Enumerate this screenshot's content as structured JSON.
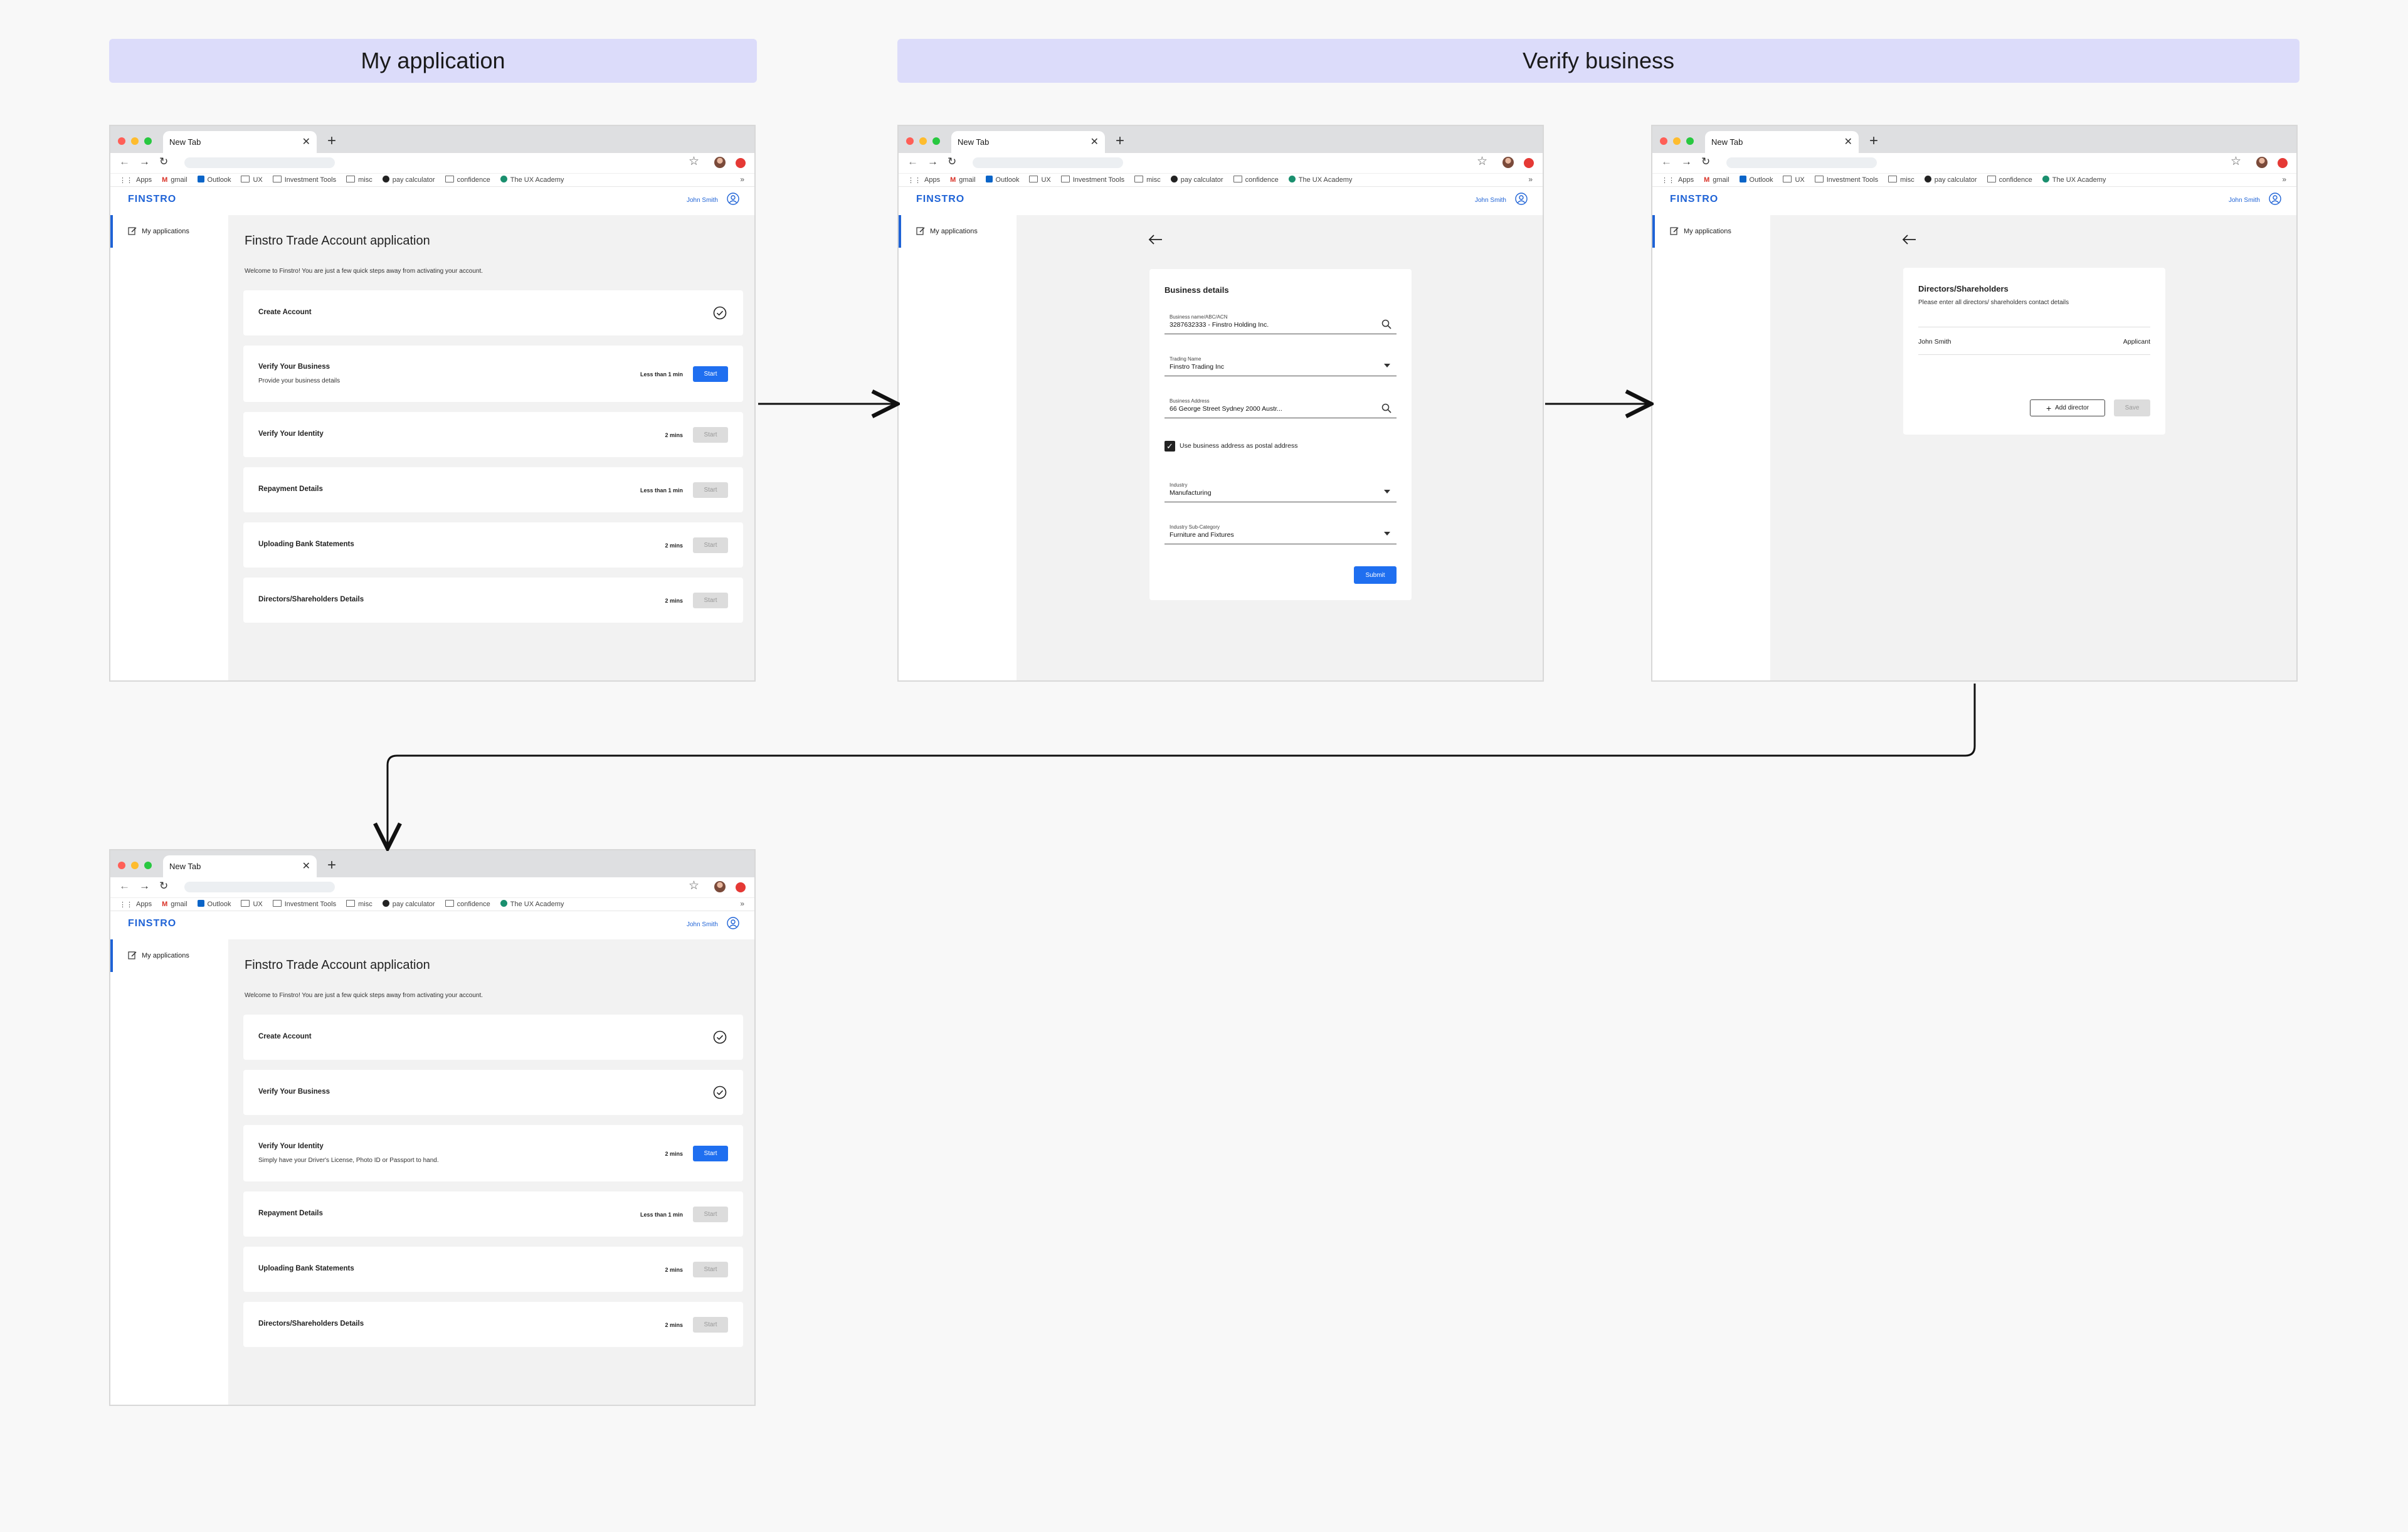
{
  "headers": {
    "my_application": "My application",
    "verify_business": "Verify business"
  },
  "colors": {
    "accent": "#1f63d6",
    "header_bg": "#dcdcfa",
    "primary_button": "#1f6ff0",
    "traffic_red": "#ff5f57",
    "traffic_yellow": "#febc2e",
    "traffic_green": "#28c840"
  },
  "browser": {
    "tab_title": "New Tab",
    "bookmarks": [
      {
        "label": "Apps",
        "icon": "apps-grid-icon"
      },
      {
        "label": "gmail",
        "icon": "gmail-icon"
      },
      {
        "label": "Outlook",
        "icon": "outlook-icon"
      },
      {
        "label": "UX",
        "icon": "folder-icon"
      },
      {
        "label": "Investment Tools",
        "icon": "folder-icon"
      },
      {
        "label": "misc",
        "icon": "folder-icon"
      },
      {
        "label": "pay calculator",
        "icon": "pay-calculator-icon"
      },
      {
        "label": "confidence",
        "icon": "folder-icon"
      },
      {
        "label": "The UX Academy",
        "icon": "ux-academy-icon"
      }
    ],
    "more": "»"
  },
  "app": {
    "logo": "FINSTRO",
    "user_name": "John Smith",
    "sidebar_item": "My applications"
  },
  "application": {
    "title": "Finstro Trade Account application",
    "welcome": "Welcome to Finstro! You are just a few quick steps away from activating your account.",
    "start_label": "Start"
  },
  "screen1_steps": [
    {
      "title": "Create Account",
      "desc": "",
      "time": "",
      "status": "done"
    },
    {
      "title": "Verify Your Business",
      "desc": "Provide your business details",
      "time": "Less than 1 min",
      "status": "active"
    },
    {
      "title": "Verify Your Identity",
      "desc": "",
      "time": "2 mins",
      "status": "disabled"
    },
    {
      "title": "Repayment Details",
      "desc": "",
      "time": "Less than 1 min",
      "status": "disabled"
    },
    {
      "title": "Uploading Bank Statements",
      "desc": "",
      "time": "2 mins",
      "status": "disabled"
    },
    {
      "title": "Directors/Shareholders Details",
      "desc": "",
      "time": "2 mins",
      "status": "disabled"
    }
  ],
  "screen4_steps": [
    {
      "title": "Create Account",
      "desc": "",
      "time": "",
      "status": "done"
    },
    {
      "title": "Verify Your Business",
      "desc": "",
      "time": "",
      "status": "done"
    },
    {
      "title": "Verify Your Identity",
      "desc": "Simply have your Driver's License, Photo ID or Passport to hand.",
      "time": "2 mins",
      "status": "active"
    },
    {
      "title": "Repayment Details",
      "desc": "",
      "time": "Less than 1 min",
      "status": "disabled"
    },
    {
      "title": "Uploading Bank Statements",
      "desc": "",
      "time": "2 mins",
      "status": "disabled"
    },
    {
      "title": "Directors/Shareholders Details",
      "desc": "",
      "time": "2 mins",
      "status": "disabled"
    }
  ],
  "business_form": {
    "title": "Business details",
    "abn_label": "Business name/ABC/ACN",
    "abn_value": "3287632333 - Finstro Holding Inc.",
    "trading_label": "Trading Name",
    "trading_value": "Finstro Trading Inc",
    "address_label": "Business Address",
    "address_value": "66 George Street Sydney 2000 Austr...",
    "postal_checkbox": "Use business address as postal address",
    "postal_checked": true,
    "industry_label": "Industry",
    "industry_value": "Manufacturing",
    "subcat_label": "Industry Sub-Category",
    "subcat_value": "Furniture and Fixtures",
    "submit": "Submit"
  },
  "directors_form": {
    "title": "Directors/Shareholders",
    "subtitle": "Please enter all directors/ shareholders contact details",
    "director_name": "John Smith",
    "director_role": "Applicant",
    "add_button": "Add director",
    "save_button": "Save"
  }
}
